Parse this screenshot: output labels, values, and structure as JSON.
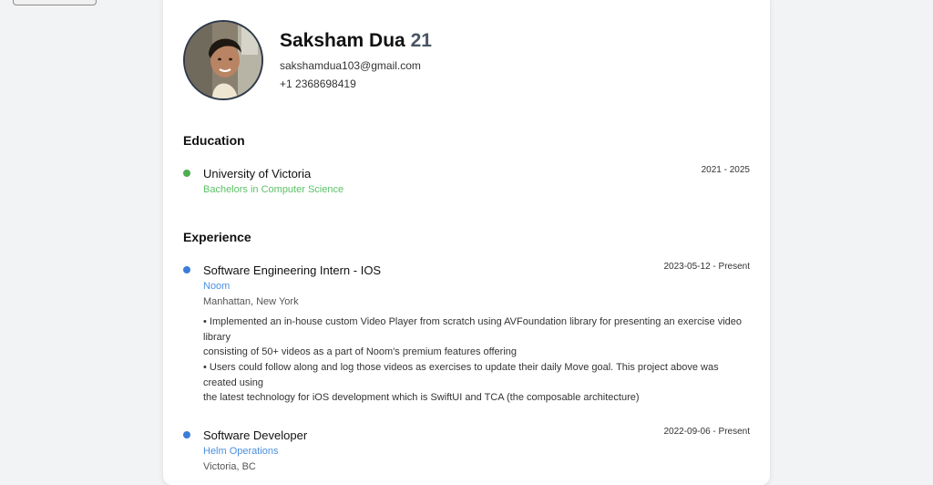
{
  "profile": {
    "name": "Saksham Dua",
    "age": "21",
    "email": "sakshamdua103@gmail.com",
    "phone": "+1 2368698419"
  },
  "education": {
    "title": "Education",
    "items": [
      {
        "school": "University of Victoria",
        "degree": "Bachelors in Computer Science",
        "dates": "2021 - 2025",
        "accent": "#4caf50"
      }
    ]
  },
  "experience": {
    "title": "Experience",
    "items": [
      {
        "role": "Software Engineering Intern - IOS",
        "company": "Noom",
        "location": "Manhattan, New York",
        "dates": "2023-05-12 - Present",
        "description": [
          "• Implemented an in-house custom Video Player from scratch using AVFoundation library for presenting an exercise video",
          "library",
          "consisting of 50+ videos as a part of Noom's premium features offering",
          "• Users could follow along and log those videos as exercises to update their daily Move goal. This project above was",
          "created using",
          "the latest technology for iOS development which is SwiftUI and TCA (the composable architecture)"
        ],
        "accent": "#3b7dd8"
      },
      {
        "role": "Software Developer",
        "company": "Helm Operations",
        "location": "Victoria, BC",
        "dates": "2022-09-06 - Present",
        "accent": "#3b7dd8"
      }
    ]
  },
  "colors": {
    "education_link": "#5cc168",
    "experience_link": "#4a8fe0"
  }
}
